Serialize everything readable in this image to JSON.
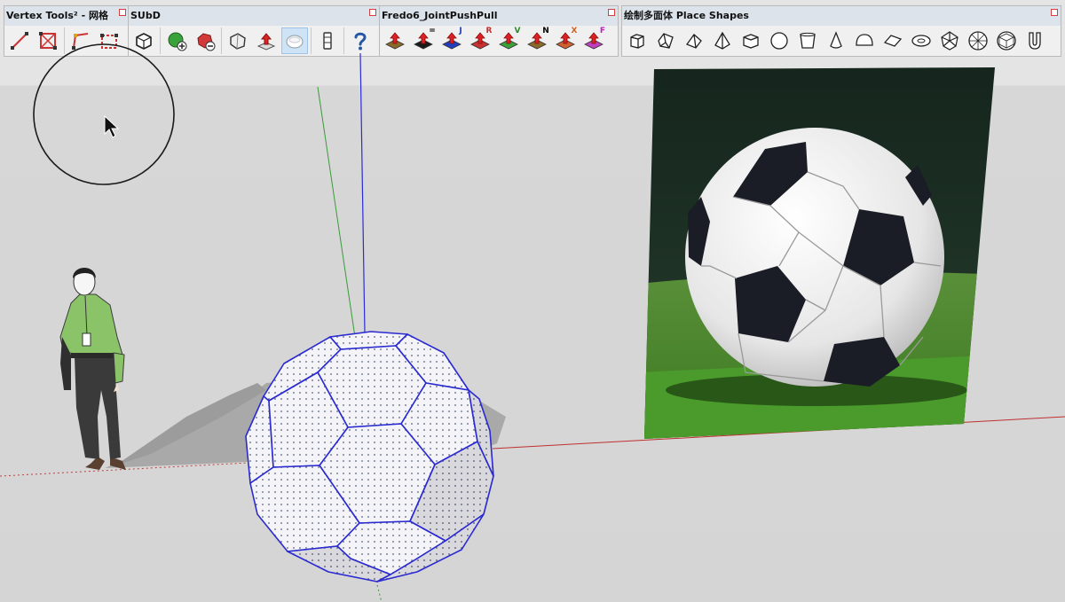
{
  "toolbars": {
    "vertex": {
      "title": "Vertex Tools² - 网格",
      "buttons": [
        "vertex-line-icon",
        "vertex-box-icon",
        "vertex-move-icon",
        "vertex-select-icon"
      ]
    },
    "subd": {
      "title": "SUbD",
      "buttons": [
        "subd-cube-icon",
        "subd-add-icon",
        "subd-remove-icon",
        "subd-crease-icon",
        "subd-push-icon",
        "subd-smooth-icon",
        "subd-freeze-icon",
        "subd-help-icon"
      ]
    },
    "fredo": {
      "title": "Fredo6_JointPushPull",
      "labels": [
        "",
        "=",
        "J",
        "R",
        "V",
        "N",
        "X",
        "F"
      ]
    },
    "shapes": {
      "title": "绘制多面体 Place Shapes",
      "buttons": [
        "box-icon",
        "prism-icon",
        "wedge-icon",
        "pyramid-icon",
        "cylinder-box-icon",
        "circle-icon",
        "cup-icon",
        "cone-icon",
        "dome-icon",
        "lens-icon",
        "torus-icon",
        "polyhedron-icon",
        "geosphere-icon",
        "icosphere-icon",
        "tube-icon"
      ]
    }
  },
  "colors": {
    "background": "#d5d5d5",
    "axis_red": "#c03030",
    "axis_green": "#3a9a3a",
    "axis_blue": "#2b2bd6",
    "edge_blue": "#2a2ad0",
    "face_fill": "#f4f4f8",
    "grass": "#3f8a2a",
    "photo_dark": "#1b2a22"
  },
  "cursor": {
    "type": "arrow-pointer"
  }
}
